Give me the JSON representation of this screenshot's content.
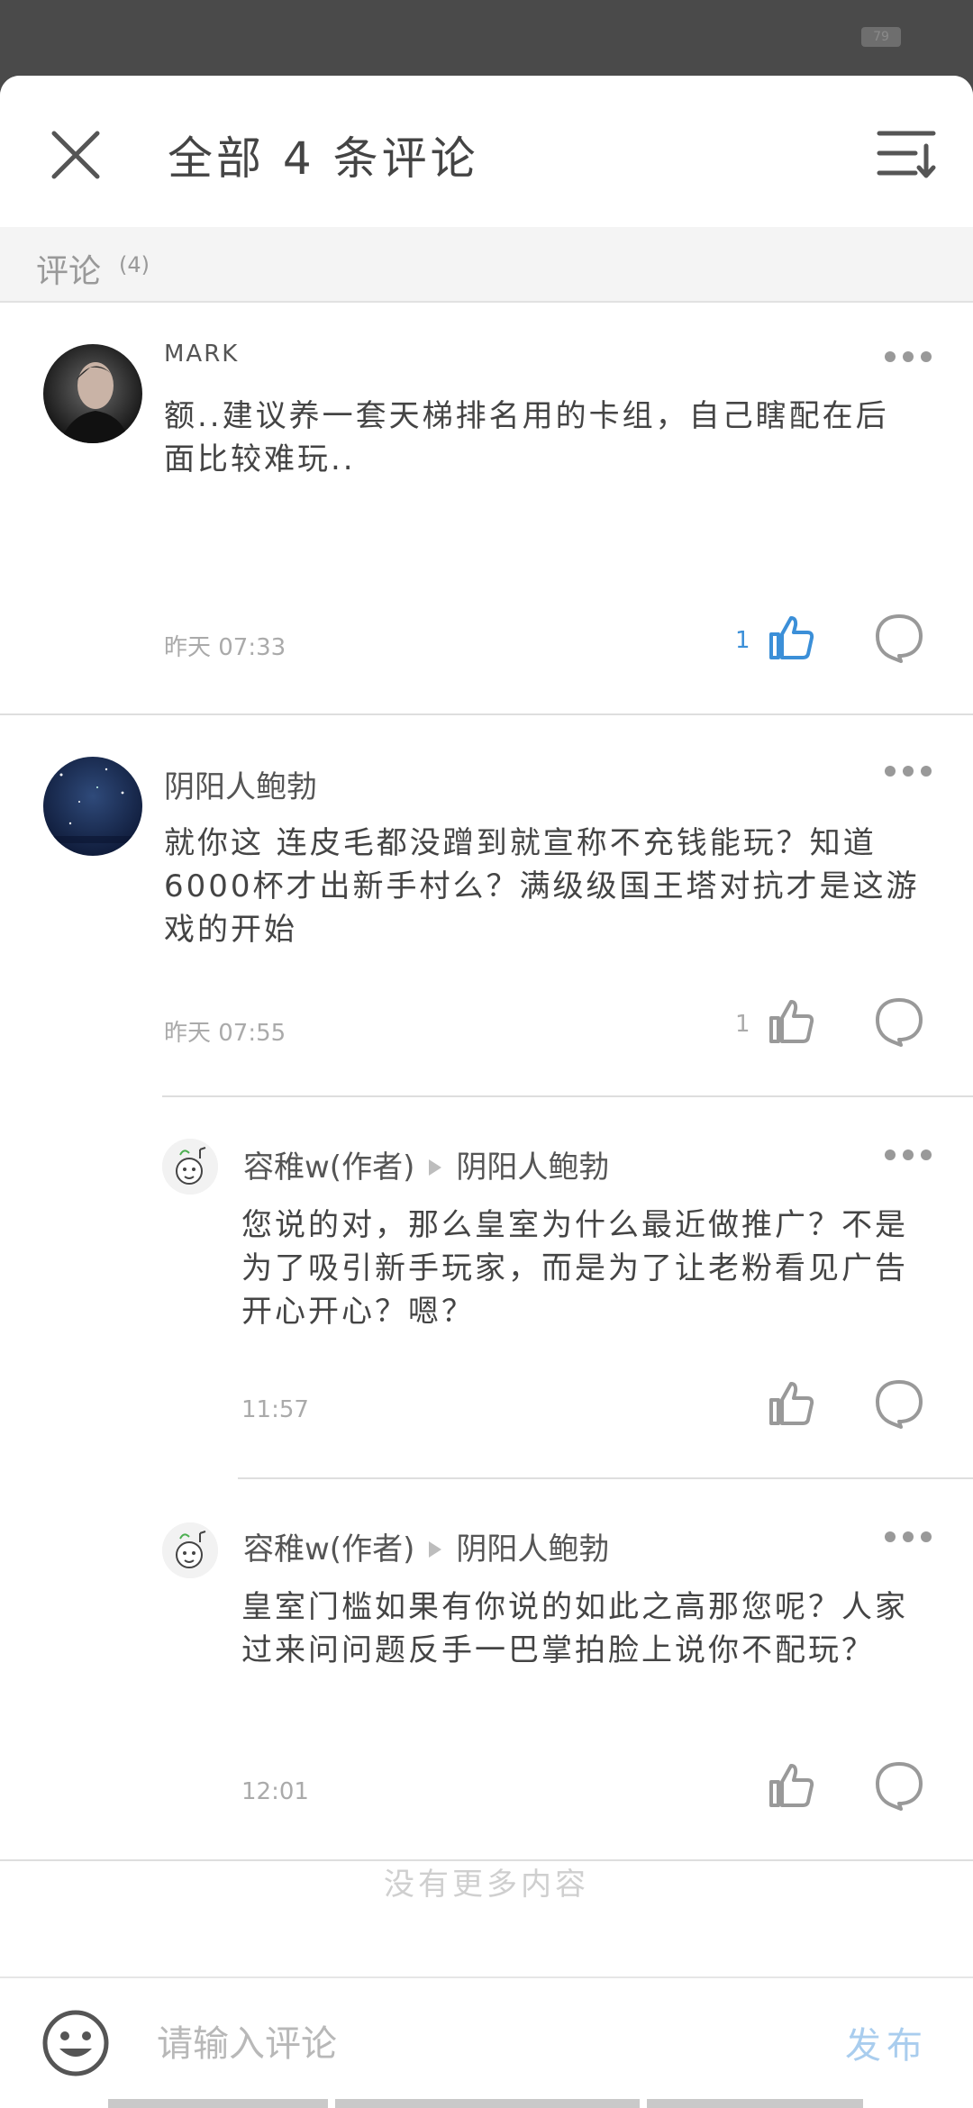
{
  "status_bar": {
    "battery": "79"
  },
  "header": {
    "title": "全部 4 条评论",
    "close_icon": "close-icon",
    "sort_icon": "sort-icon"
  },
  "subheader": {
    "label": "评论",
    "count": "(4)"
  },
  "comments": [
    {
      "username": "MARK",
      "text": "额..建议养一套天梯排名用的卡组，自己瞎配在后面比较难玩..",
      "time": "昨天 07:33",
      "likes": "1",
      "liked": true,
      "avatar_icon": "user-avatar-photo"
    },
    {
      "username": "阴阳人鲍勃",
      "text": "就你这 连皮毛都没蹭到就宣称不充钱能玩？知道6000杯才出新手村么？满级级国王塔对抗才是这游戏的开始",
      "time": "昨天 07:55",
      "likes": "1",
      "liked": false,
      "avatar_icon": "user-avatar-night-sky",
      "replies": [
        {
          "username": "容稚w(作者)",
          "reply_to": "阴阳人鲍勃",
          "text": "您说的对，那么皇室为什么最近做推广？不是为了吸引新手玩家，而是为了让老粉看见广告开心开心？嗯？",
          "time": "11:57",
          "avatar_icon": "user-avatar-cartoon"
        },
        {
          "username": "容稚w(作者)",
          "reply_to": "阴阳人鲍勃",
          "text": "皇室门槛如果有你说的如此之高那您呢？人家过来问问题反手一巴掌拍脸上说你不配玩？",
          "time": "12:01",
          "avatar_icon": "user-avatar-cartoon"
        }
      ]
    }
  ],
  "no_more": "没有更多内容",
  "footer": {
    "placeholder": "请输入评论",
    "publish": "发布",
    "emoji_icon": "emoji-icon"
  },
  "colors": {
    "accent": "#3b8fd8",
    "publish_disabled": "#a9cdee",
    "status_bar": "#4a4a4a",
    "subheader_bg": "#f4f4f4"
  }
}
